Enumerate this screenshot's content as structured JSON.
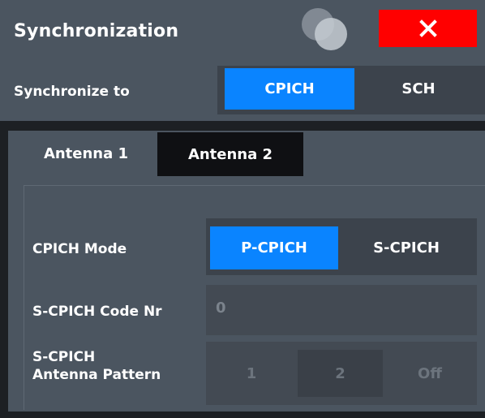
{
  "dialog": {
    "title": "Synchronization",
    "close_label": "X"
  },
  "sync": {
    "label": "Synchronize to",
    "options": [
      "CPICH",
      "SCH"
    ],
    "selected": "CPICH"
  },
  "tabs": [
    {
      "label": "Antenna 1",
      "active": true
    },
    {
      "label": "Antenna 2",
      "active": false
    }
  ],
  "antenna": {
    "cpich_mode_label": "CPICH Mode",
    "cpich_mode_options": [
      "P-CPICH",
      "S-CPICH"
    ],
    "cpich_mode_selected": "P-CPICH",
    "code_nr_label": "S-CPICH Code Nr",
    "code_nr_value": "0",
    "pattern_label_line1": "S-CPICH",
    "pattern_label_line2": "Antenna Pattern",
    "pattern_options": [
      "1",
      "2",
      "Off"
    ],
    "pattern_selected": "2"
  },
  "colors": {
    "accent": "#0a84ff",
    "close": "#ff0000",
    "panel": "#4b5560"
  }
}
